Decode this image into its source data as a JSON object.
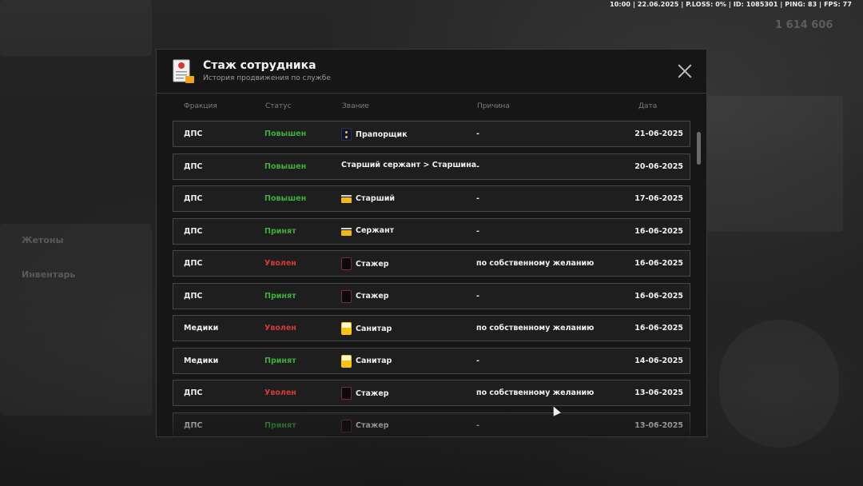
{
  "hud": {
    "info": "10:00 | 22.06.2025 | P.LOSS: 0% | ID: 1085301 | PING: 83 | FPS: 77"
  },
  "background": {
    "money": "1 614 606",
    "tokens_label": "Жетоны",
    "inventory_label": "Инвентарь"
  },
  "modal": {
    "title": "Стаж сотрудника",
    "subtitle": "История продвижения по службе",
    "columns": {
      "faction": "Фракция",
      "status": "Статус",
      "rank": "Звание",
      "reason": "Причина",
      "date": "Дата"
    },
    "rows": [
      {
        "faction": "ДПС",
        "status": "Повышен",
        "status_type": "promoted",
        "badge": "navy",
        "rank": "Прапорщик",
        "reason": "-",
        "date": "21-06-2025"
      },
      {
        "faction": "ДПС",
        "status": "Повышен",
        "status_type": "promoted",
        "badge": "",
        "rank": "Старший сержант > Старшина",
        "reason": "-",
        "date": "20-06-2025"
      },
      {
        "faction": "ДПС",
        "status": "Повышен",
        "status_type": "promoted",
        "badge": "gold",
        "rank": "Старший",
        "reason": "-",
        "date": "17-06-2025"
      },
      {
        "faction": "ДПС",
        "status": "Принят",
        "status_type": "hired",
        "badge": "gold",
        "rank": "Сержант",
        "reason": "-",
        "date": "16-06-2025"
      },
      {
        "faction": "ДПС",
        "status": "Уволен",
        "status_type": "fired",
        "badge": "intern",
        "rank": "Стажер",
        "reason": "по собственному желанию",
        "date": "16-06-2025"
      },
      {
        "faction": "ДПС",
        "status": "Принят",
        "status_type": "hired",
        "badge": "intern",
        "rank": "Стажер",
        "reason": "-",
        "date": "16-06-2025"
      },
      {
        "faction": "Медики",
        "status": "Уволен",
        "status_type": "fired",
        "badge": "medic",
        "rank": "Санитар",
        "reason": "по собственному желанию",
        "date": "16-06-2025"
      },
      {
        "faction": "Медики",
        "status": "Принят",
        "status_type": "hired",
        "badge": "medic",
        "rank": "Санитар",
        "reason": "-",
        "date": "14-06-2025"
      },
      {
        "faction": "ДПС",
        "status": "Уволен",
        "status_type": "fired",
        "badge": "intern",
        "rank": "Стажер",
        "reason": "по собственному желанию",
        "date": "13-06-2025"
      },
      {
        "faction": "ДПС",
        "status": "Принят",
        "status_type": "hired",
        "badge": "intern",
        "rank": "Стажер",
        "reason": "-",
        "date": "13-06-2025"
      }
    ]
  },
  "icons": {
    "document": "document-icon",
    "close": "close-icon",
    "cursor": "mouse-cursor-icon"
  }
}
